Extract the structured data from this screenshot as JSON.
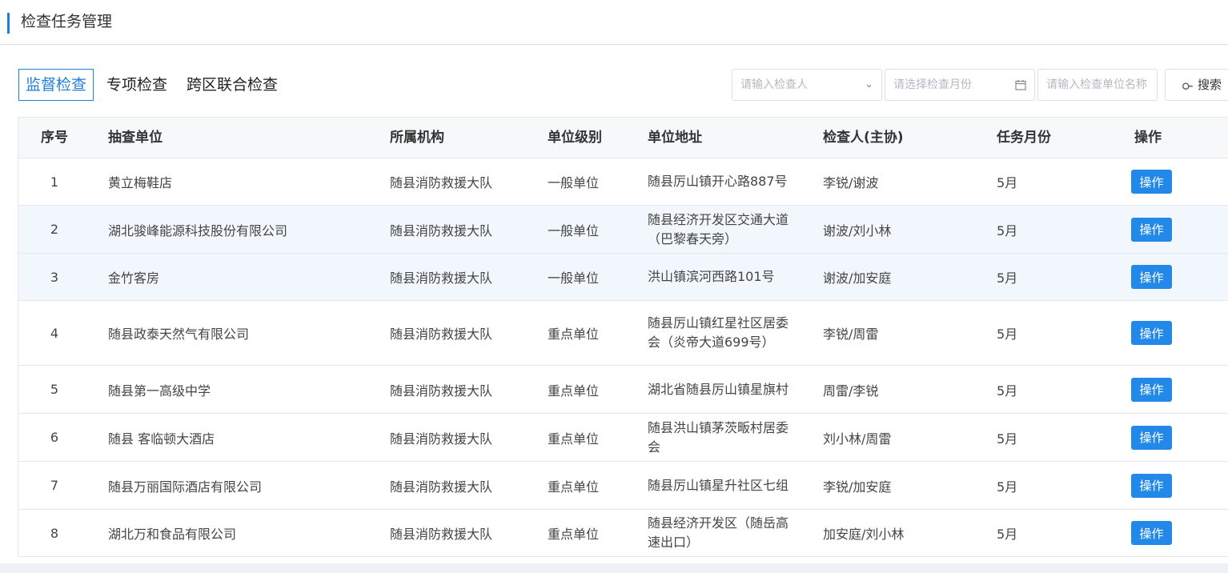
{
  "header": {
    "title": "检查任务管理"
  },
  "tabs": [
    {
      "label": "监督检查",
      "active": true
    },
    {
      "label": "专项检查",
      "active": false
    },
    {
      "label": "跨区联合检查",
      "active": false
    }
  ],
  "filters": {
    "inspector_placeholder": "请输入检查人",
    "month_placeholder": "请选择检查月份",
    "unit_placeholder": "请输入检查单位名称",
    "search_label": "搜索"
  },
  "table": {
    "columns": [
      "序号",
      "抽查单位",
      "所属机构",
      "单位级别",
      "单位地址",
      "检查人(主协)",
      "任务月份",
      "操作"
    ],
    "rows": [
      {
        "idx": "1",
        "unit": "黄立梅鞋店",
        "org": "随县消防救援大队",
        "level": "一般单位",
        "addr": "随县厉山镇开心路887号",
        "inspector": "李锐/谢波",
        "month": "5月",
        "op": "操作"
      },
      {
        "idx": "2",
        "unit": "湖北骏峰能源科技股份有限公司",
        "org": "随县消防救援大队",
        "level": "一般单位",
        "addr": "随县经济开发区交通大道（巴黎春天旁）",
        "inspector": "谢波/刘小林",
        "month": "5月",
        "op": "操作"
      },
      {
        "idx": "3",
        "unit": "金竹客房",
        "org": "随县消防救援大队",
        "level": "一般单位",
        "addr": "洪山镇滨河西路101号",
        "inspector": "谢波/加安庭",
        "month": "5月",
        "op": "操作"
      },
      {
        "idx": "4",
        "unit": "随县政泰天然气有限公司",
        "org": "随县消防救援大队",
        "level": "重点单位",
        "addr": "随县厉山镇红星社区居委会（炎帝大道699号）",
        "inspector": "李锐/周雷",
        "month": "5月",
        "op": "操作"
      },
      {
        "idx": "5",
        "unit": "随县第一高级中学",
        "org": "随县消防救援大队",
        "level": "重点单位",
        "addr": "湖北省随县厉山镇星旗村",
        "inspector": "周雷/李锐",
        "month": "5月",
        "op": "操作"
      },
      {
        "idx": "6",
        "unit": "随县 客临顿大酒店",
        "org": "随县消防救援大队",
        "level": "重点单位",
        "addr": "随县洪山镇茅茨畈村居委会",
        "inspector": "刘小林/周雷",
        "month": "5月",
        "op": "操作"
      },
      {
        "idx": "7",
        "unit": "随县万丽国际酒店有限公司",
        "org": "随县消防救援大队",
        "level": "重点单位",
        "addr": "随县厉山镇星升社区七组",
        "inspector": "李锐/加安庭",
        "month": "5月",
        "op": "操作"
      },
      {
        "idx": "8",
        "unit": "湖北万和食品有限公司",
        "org": "随县消防救援大队",
        "level": "重点单位",
        "addr": "随县经济开发区（随岳高速出口）",
        "inspector": "加安庭/刘小林",
        "month": "5月",
        "op": "操作"
      }
    ]
  }
}
